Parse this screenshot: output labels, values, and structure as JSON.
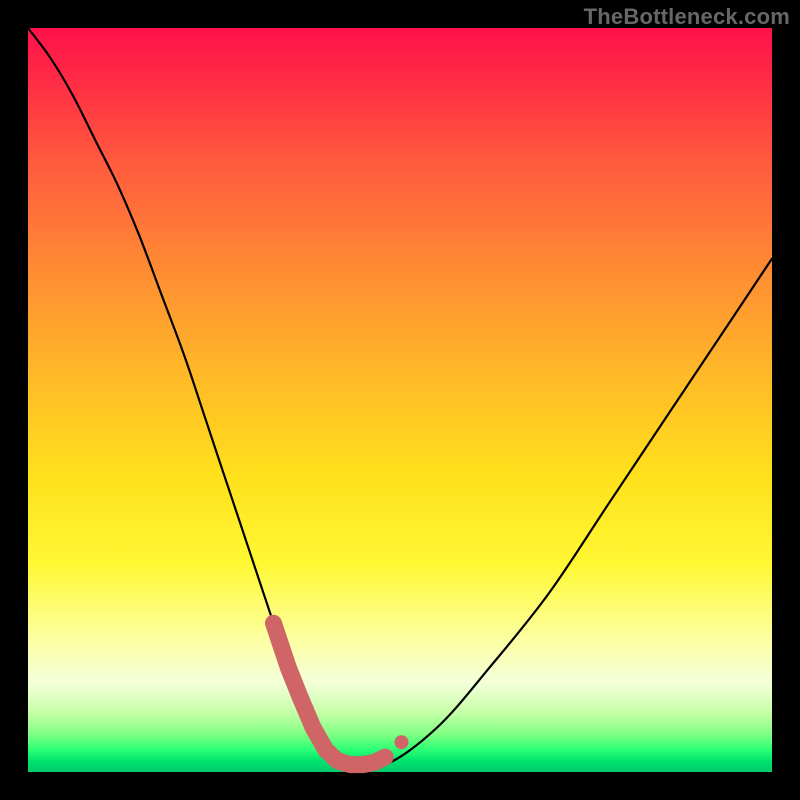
{
  "watermark": "TheBottleneck.com",
  "colors": {
    "frame": "#000000",
    "curve_line": "#000000",
    "marker_fill": "#cf6567",
    "gradient_top": "#ff114b",
    "gradient_bottom": "#00c96b"
  },
  "chart_data": {
    "type": "line",
    "title": "",
    "xlabel": "",
    "ylabel": "",
    "xlim": [
      0,
      100
    ],
    "ylim": [
      0,
      100
    ],
    "series": [
      {
        "name": "bottleneck-curve",
        "x": [
          0,
          3,
          6,
          9,
          12,
          15,
          18,
          21,
          24,
          27,
          30,
          33,
          35,
          37,
          39,
          42,
          48,
          55,
          62,
          70,
          78,
          86,
          94,
          100
        ],
        "values": [
          100,
          96,
          91,
          85,
          79,
          72,
          64,
          56,
          47,
          38,
          29,
          20,
          14,
          9,
          4,
          1,
          1,
          6,
          14,
          24,
          36,
          48,
          60,
          69
        ]
      }
    ],
    "markers": {
      "name": "highlight-points",
      "x": [
        33,
        35,
        36.6,
        38.3,
        40,
        41.6,
        43.3,
        45,
        46.6,
        48,
        50.2
      ],
      "values": [
        20,
        14,
        10,
        6,
        3,
        1.5,
        1,
        1,
        1.3,
        2,
        4
      ]
    },
    "annotations": []
  }
}
